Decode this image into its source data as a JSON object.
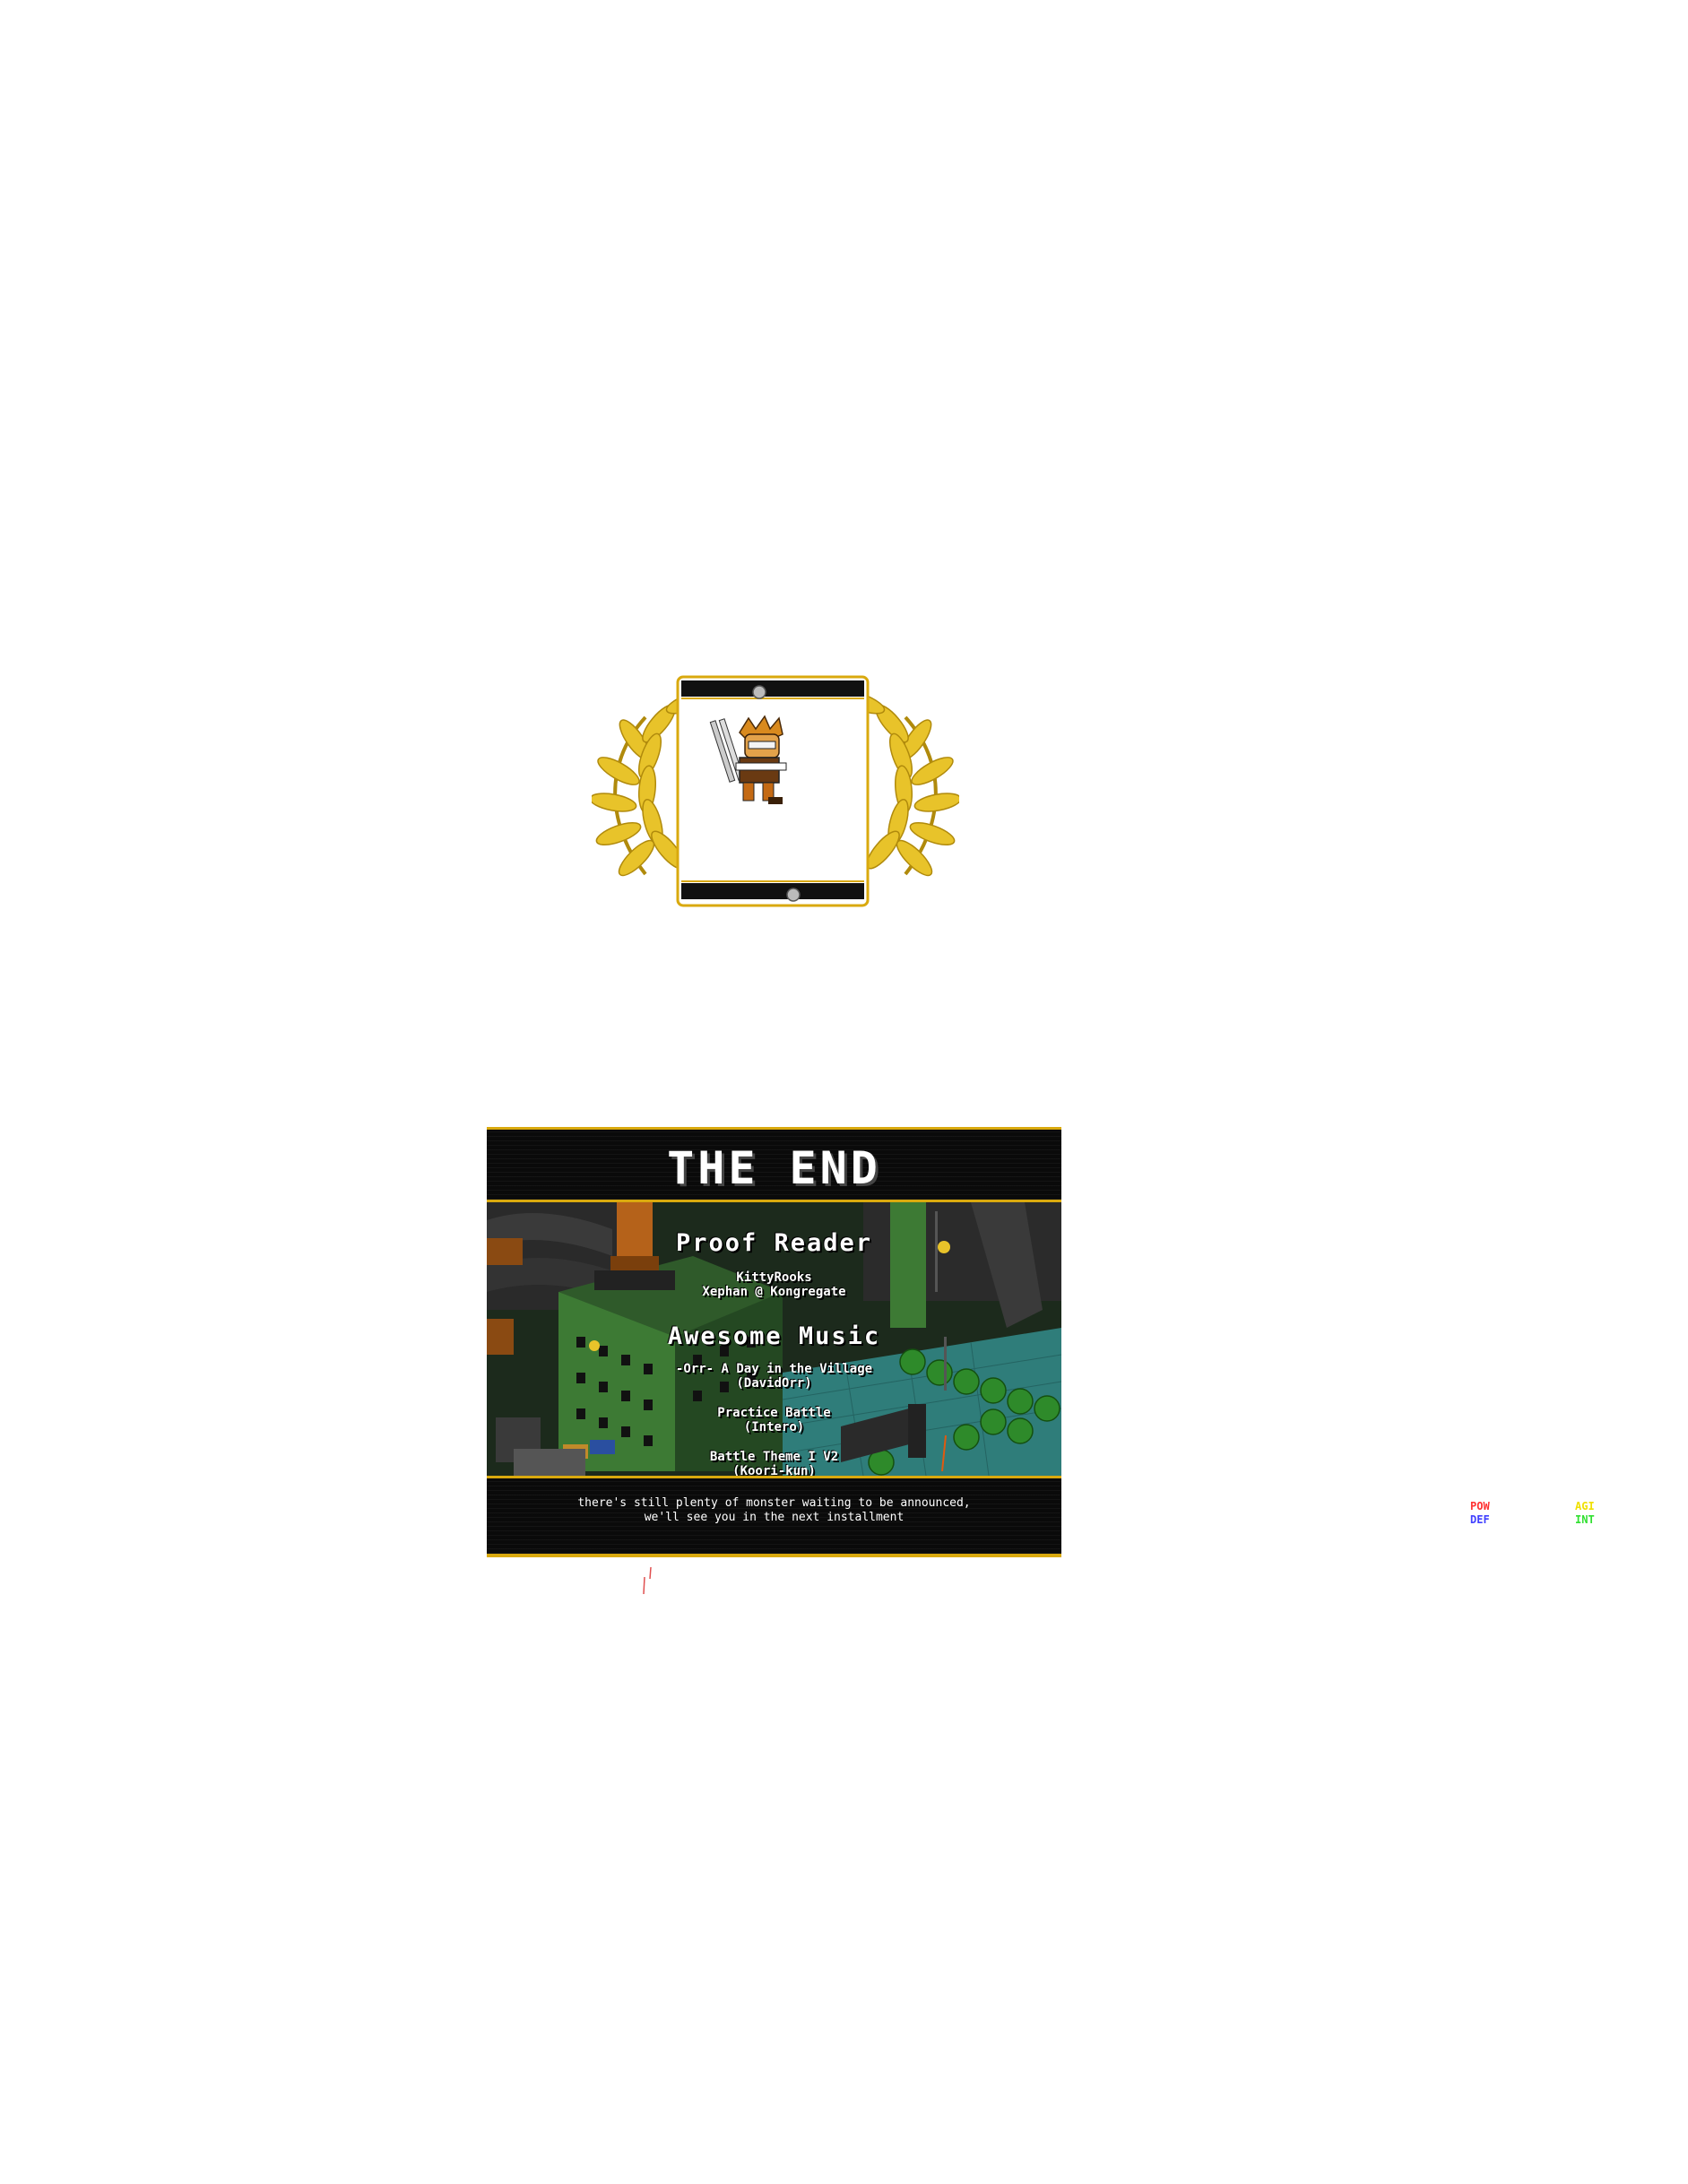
{
  "credits": {
    "title": "THE END",
    "proof_reader": {
      "heading": "Proof Reader",
      "names": [
        "KittyRooks",
        "Xephan @ Kongregate"
      ]
    },
    "music": {
      "heading": "Awesome Music",
      "tracks": [
        {
          "title": "-Orr- A Day in the Village",
          "author": "(DavidOrr)"
        },
        {
          "title": "Practice Battle",
          "author": "(Intero)"
        },
        {
          "title": "Battle Theme I V2",
          "author": "(Koori-kun)"
        }
      ]
    },
    "footer": {
      "line1": "there's still plenty of monster waiting to be announced,",
      "line2": "we'll see you in the next installment"
    }
  },
  "stats": {
    "pow": "POW",
    "def": "DEF",
    "agi": "AGI",
    "int": "INT"
  },
  "colors": {
    "gold": "#d9a90e",
    "laurel": "#e8c32a",
    "pow": "#ff3030",
    "def": "#4040ff",
    "agi": "#f0e000",
    "int": "#30e030"
  },
  "icons": [
    "laurel-wreath-icon",
    "trophy-card-icon",
    "hero-sprite-icon"
  ]
}
